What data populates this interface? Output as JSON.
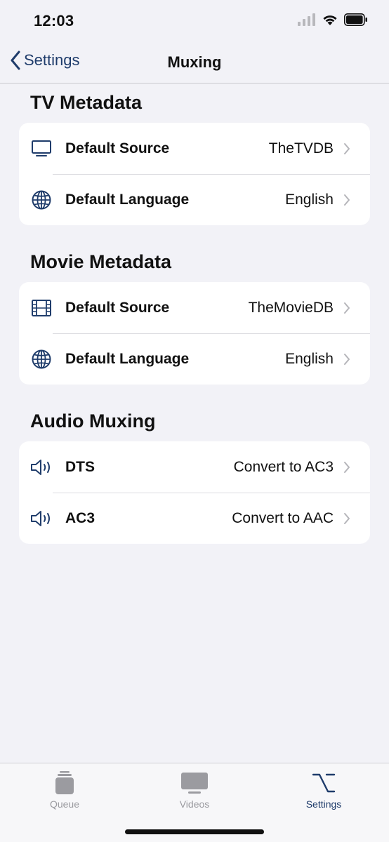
{
  "status": {
    "time": "12:03"
  },
  "nav": {
    "back_label": "Settings",
    "title": "Muxing"
  },
  "sections": [
    {
      "header": "TV Metadata",
      "rows": [
        {
          "icon": "tv-icon",
          "label": "Default Source",
          "value": "TheTVDB"
        },
        {
          "icon": "globe-icon",
          "label": "Default Language",
          "value": "English"
        }
      ]
    },
    {
      "header": "Movie Metadata",
      "rows": [
        {
          "icon": "film-icon",
          "label": "Default Source",
          "value": "TheMovieDB"
        },
        {
          "icon": "globe-icon",
          "label": "Default Language",
          "value": "English"
        }
      ]
    },
    {
      "header": "Audio Muxing",
      "rows": [
        {
          "icon": "speaker-icon",
          "label": "DTS",
          "value": "Convert to AC3"
        },
        {
          "icon": "speaker-icon",
          "label": "AC3",
          "value": "Convert to AAC"
        }
      ]
    }
  ],
  "tabs": [
    {
      "icon": "queue-icon",
      "label": "Queue",
      "active": false
    },
    {
      "icon": "videos-icon",
      "label": "Videos",
      "active": false
    },
    {
      "icon": "settings-option-icon",
      "label": "Settings",
      "active": true
    }
  ],
  "colors": {
    "accent": "#1f3c6b",
    "background": "#f2f2f7",
    "inactive_tab": "#9b9ba0"
  }
}
